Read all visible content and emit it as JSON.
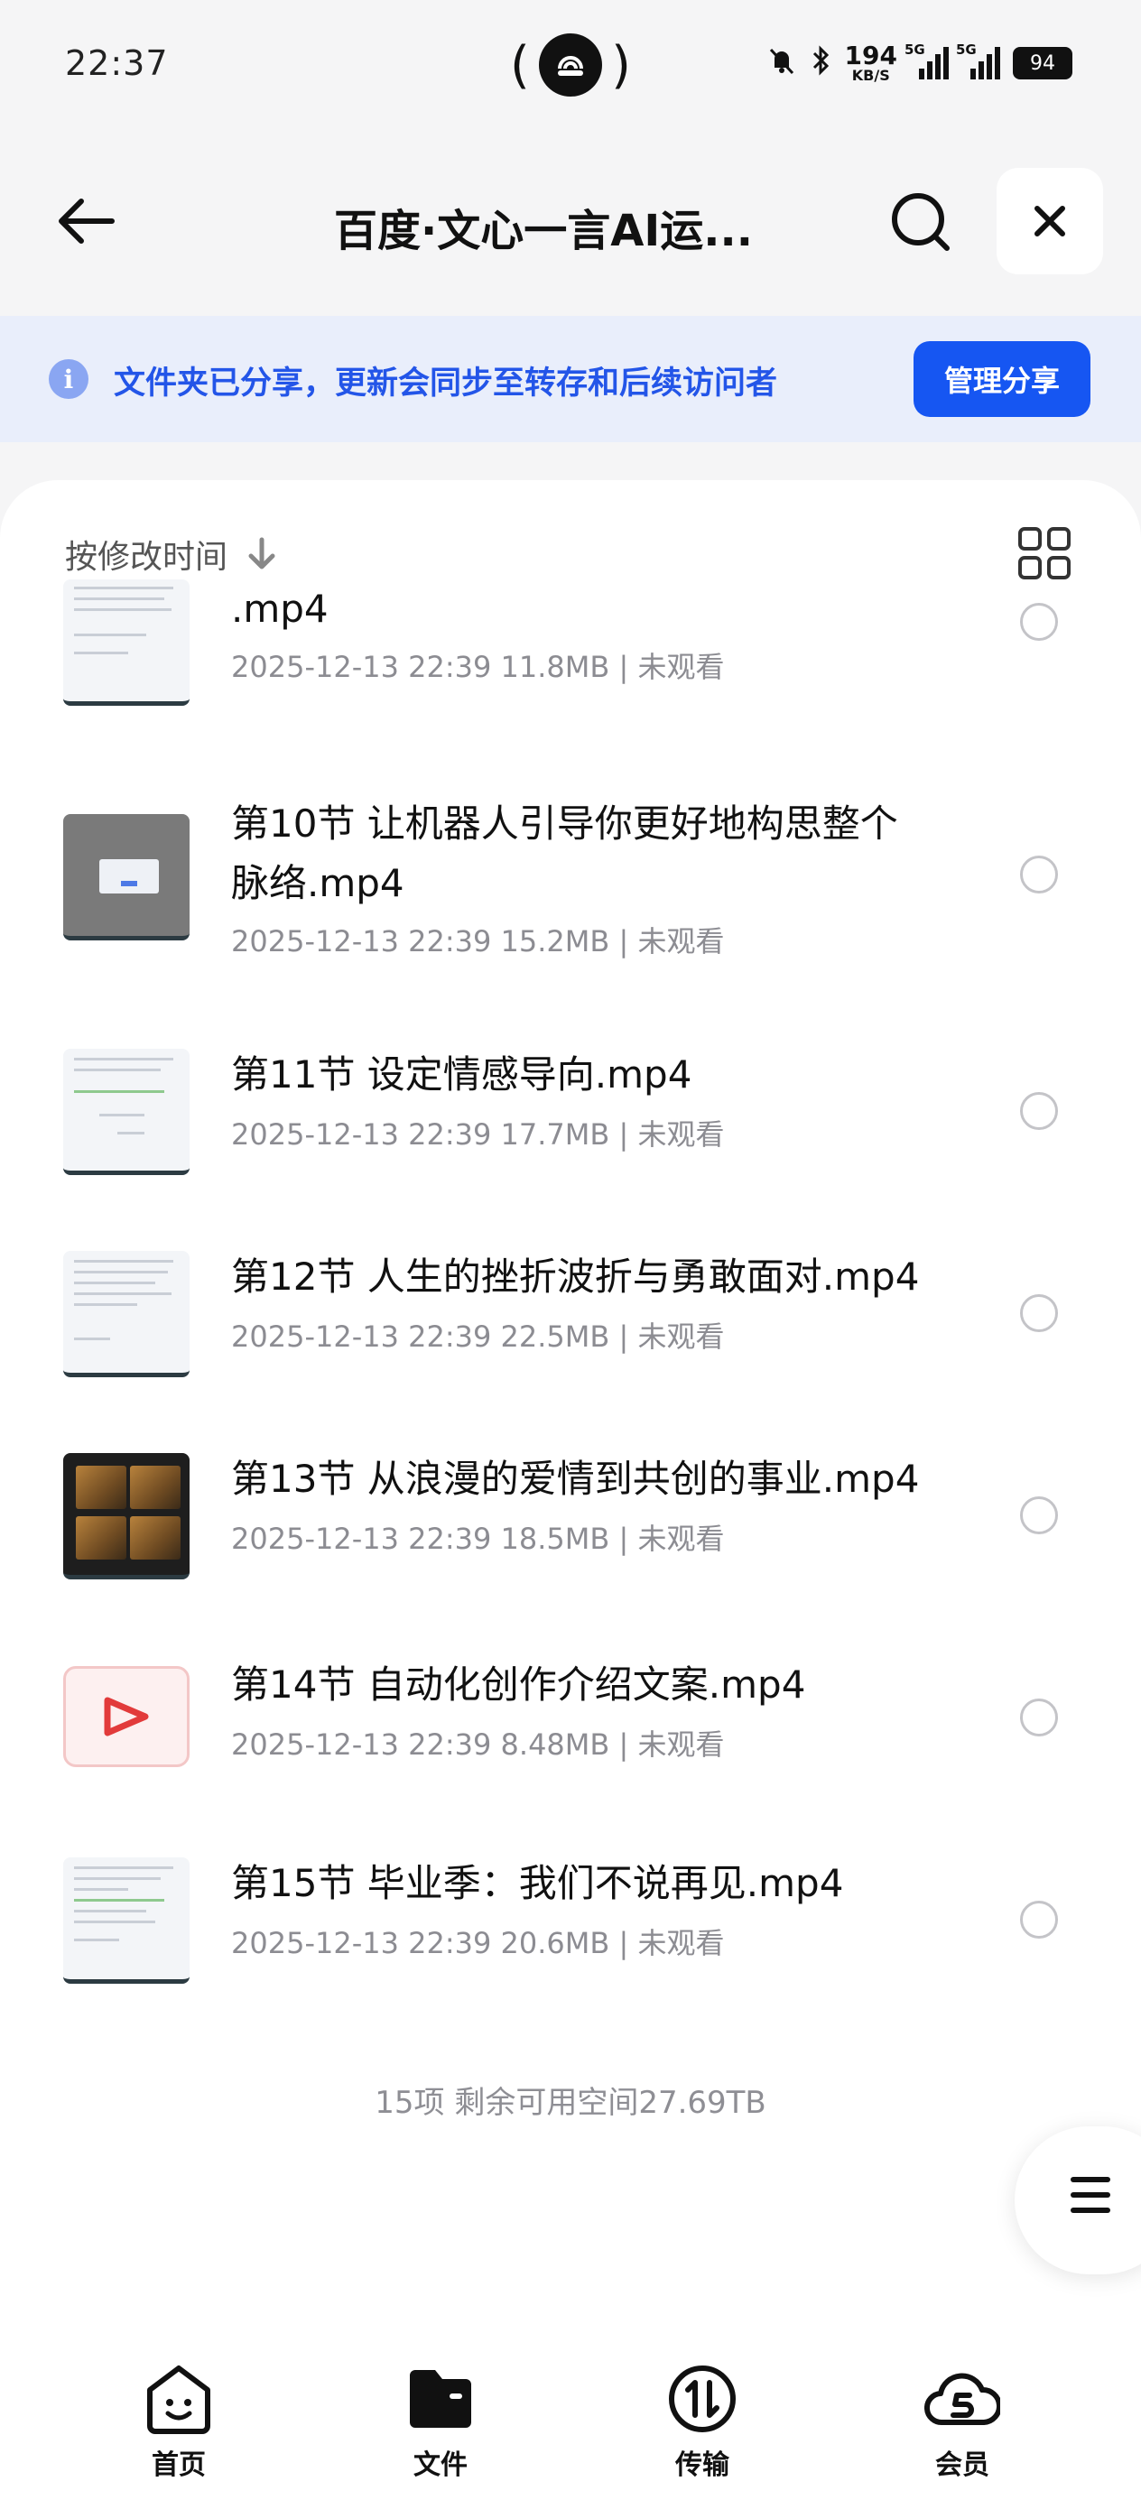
{
  "status_bar": {
    "time": "22:37",
    "net_speed_value": "194",
    "net_speed_unit": "KB/S",
    "signal1_label": "5G",
    "signal2_label": "5G",
    "battery": "94"
  },
  "header": {
    "title": "百度·文心一言AI运..."
  },
  "share_banner": {
    "message": "文件夹已分享，更新会同步至转存和后续访问者",
    "manage_button": "管理分享"
  },
  "list": {
    "sort_label": "按修改时间",
    "files": [
      {
        "name": ".mp4",
        "meta": "2025-12-13 22:39  11.8MB | 未观看",
        "thumb": "doc"
      },
      {
        "name": "第10节 让机器人引导你更好地构思整个脉络.mp4",
        "meta": "2025-12-13 22:39  15.2MB | 未观看",
        "thumb": "gray"
      },
      {
        "name": "第11节 设定情感导向.mp4",
        "meta": "2025-12-13 22:39  17.7MB | 未观看",
        "thumb": "doc"
      },
      {
        "name": "第12节 人生的挫折波折与勇敢面对.mp4",
        "meta": "2025-12-13 22:39  22.5MB | 未观看",
        "thumb": "doc"
      },
      {
        "name": "第13节 从浪漫的爱情到共创的事业.mp4",
        "meta": "2025-12-13 22:39  18.5MB | 未观看",
        "thumb": "dark"
      },
      {
        "name": "第14节 自动化创作介绍文案.mp4",
        "meta": "2025-12-13 22:39  8.48MB | 未观看",
        "thumb": "video"
      },
      {
        "name": "第15节 毕业季：我们不说再见.mp4",
        "meta": "2025-12-13 22:39  20.6MB | 未观看",
        "thumb": "doc"
      }
    ],
    "summary": "15项 剩余可用空间27.69TB"
  },
  "bottom_nav": {
    "home": "首页",
    "files": "文件",
    "transfer": "传输",
    "vip": "会员"
  },
  "icons": {
    "back": "arrow-left-icon",
    "search": "search-icon",
    "close": "close-icon",
    "info": "info-icon",
    "sort": "arrow-down-icon",
    "grid": "grid-view-icon",
    "menu": "menu-icon"
  },
  "colors": {
    "accent": "#1656f2",
    "banner_bg": "#e9eefb",
    "banner_text": "#2355e8",
    "video_red": "#e23b3b"
  }
}
